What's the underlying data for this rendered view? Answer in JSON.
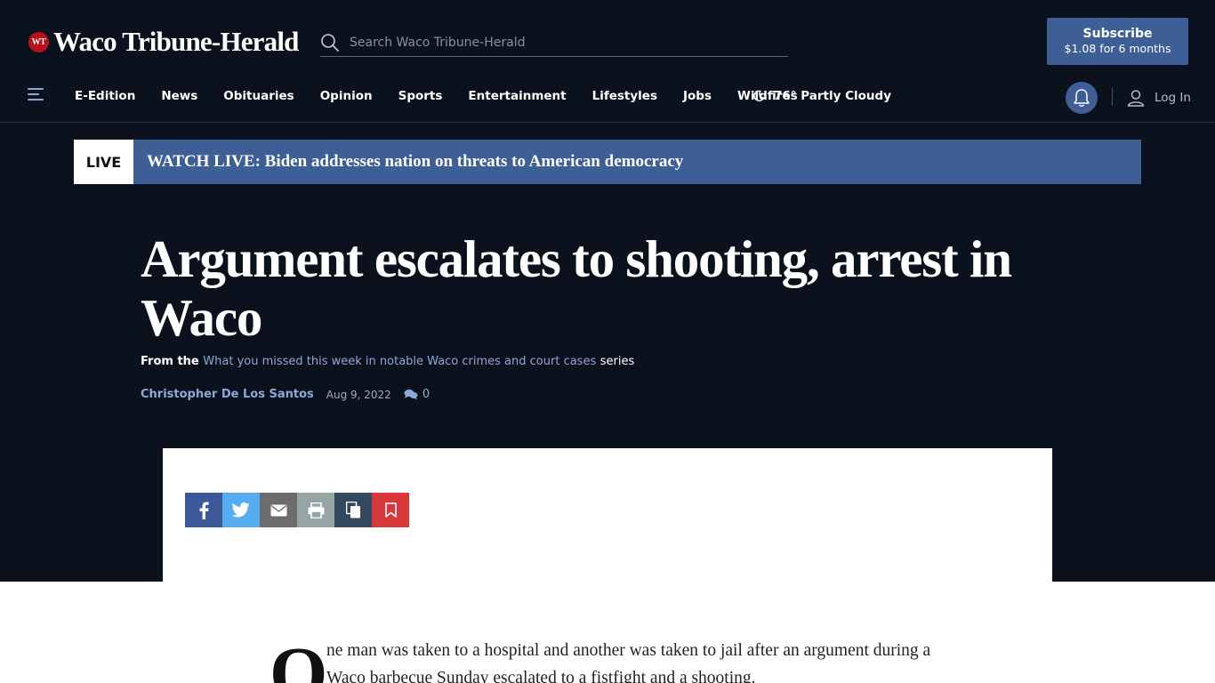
{
  "header": {
    "logo_badge": "WT",
    "logo_text": "Waco Tribune-Herald",
    "search_placeholder": "Search Waco Tribune-Herald",
    "subscribe_title": "Subscribe",
    "subscribe_price": "$1.08 for 6 months"
  },
  "nav": {
    "links": [
      "E-Edition",
      "News",
      "Obituaries",
      "Opinion",
      "Sports",
      "Entertainment",
      "Lifestyles",
      "Jobs",
      "Wildfires"
    ],
    "weather": "76° Partly Cloudy",
    "login": "Log In"
  },
  "live": {
    "tag": "LIVE",
    "text": "WATCH LIVE: Biden addresses nation on threats to American democracy"
  },
  "article": {
    "headline": "Argument escalates to shooting, arrest in Waco",
    "series_prefix": "From the",
    "series_link": "What you missed this week in notable Waco crimes and court cases",
    "series_suffix": "series",
    "author": "Christopher De Los Santos",
    "date": "Aug 9, 2022",
    "comment_count": "0",
    "dropcap": "O",
    "body": "ne man was taken to a hospital and another was taken to jail after an argument during a Waco barbecue Sunday escalated to a fistfight and a shooting."
  },
  "share": {
    "buttons": [
      "facebook-icon",
      "twitter-icon",
      "envelope-icon",
      "print-icon",
      "copy-icon",
      "bookmark-icon"
    ]
  },
  "colors": {
    "dark_bg": "#0c121d",
    "accent_blue": "#3e5e96",
    "link_blue": "#8ea8d6",
    "brand_red": "#b5121b"
  }
}
